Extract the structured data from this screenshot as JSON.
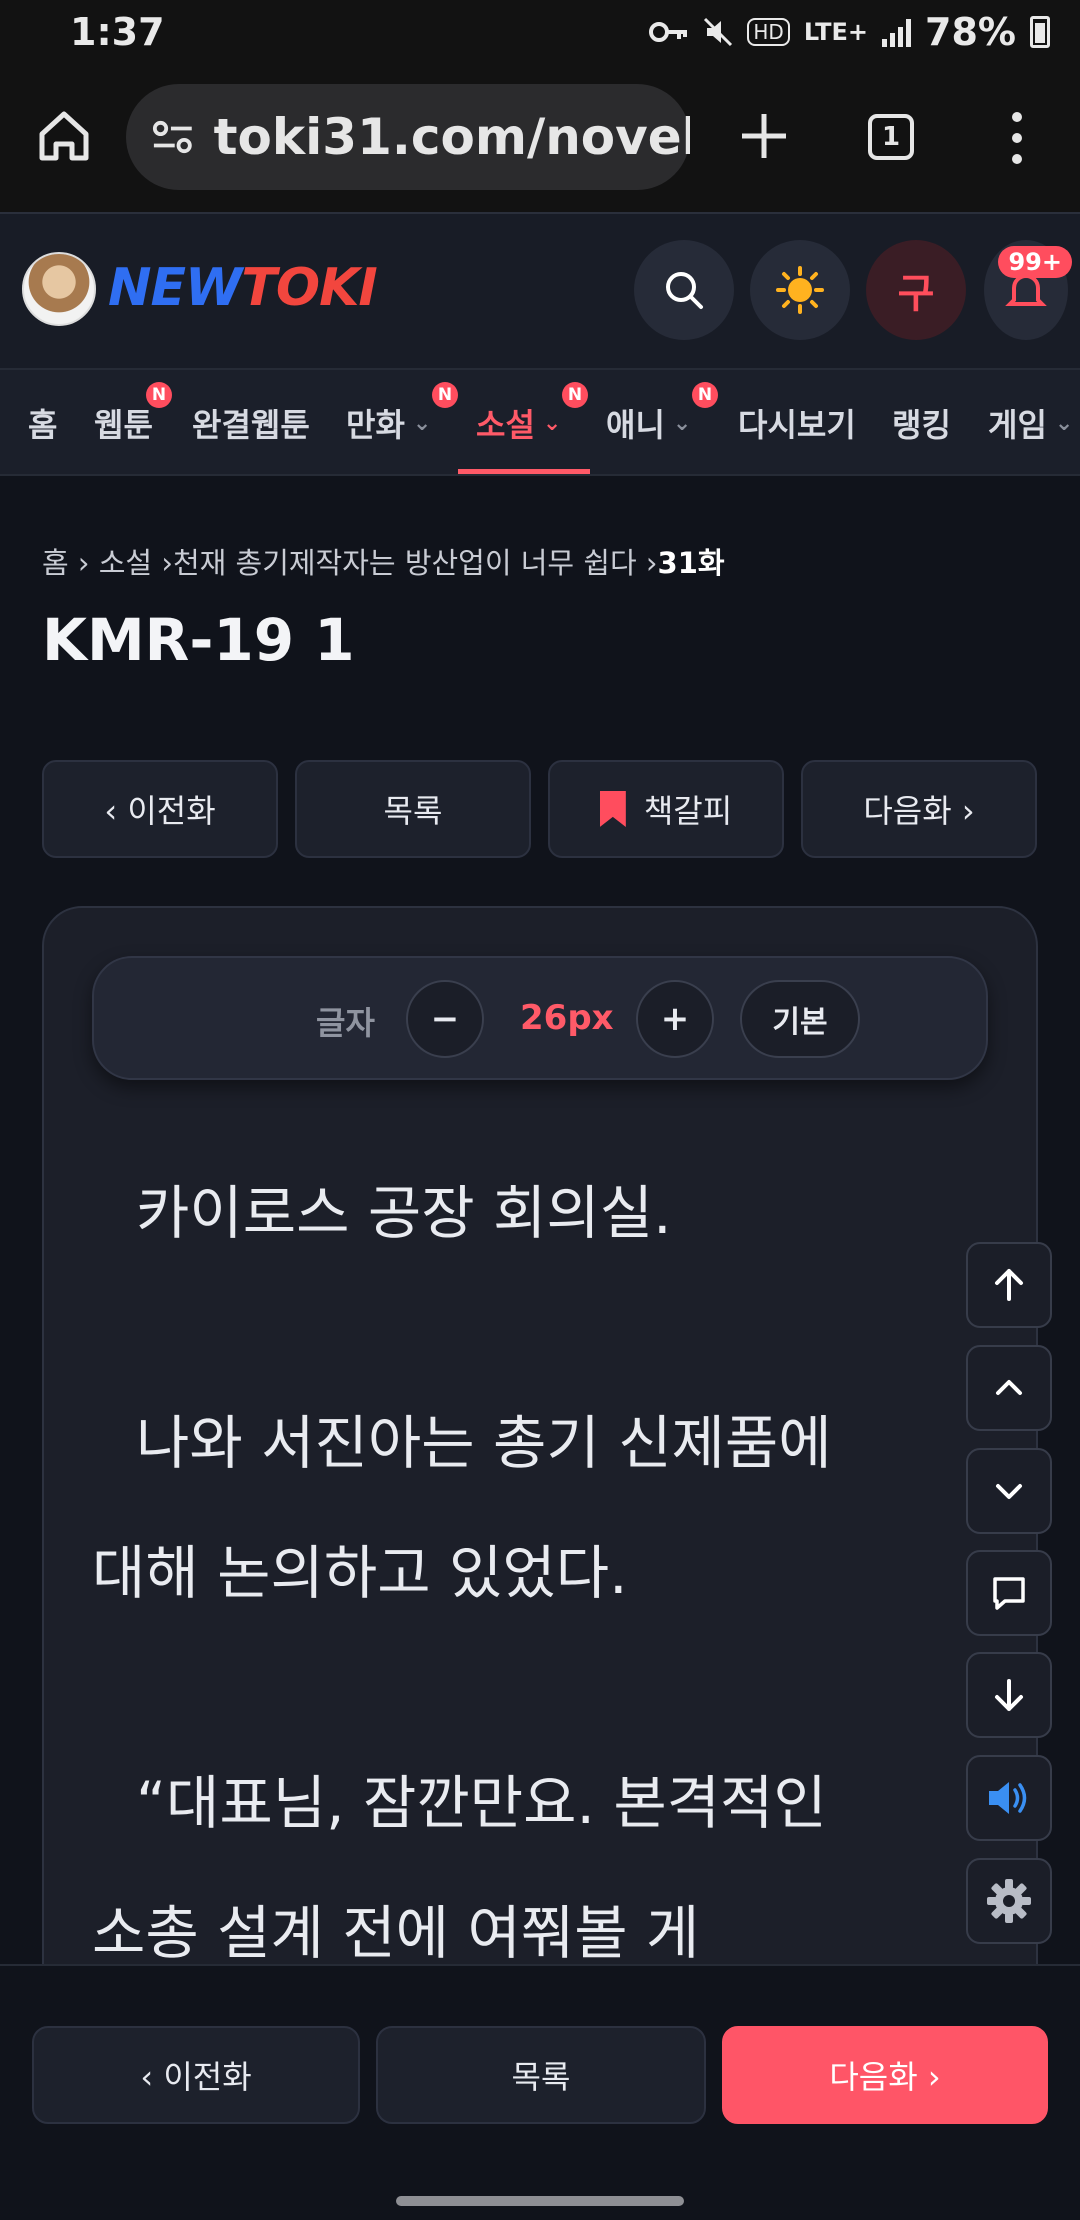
{
  "status": {
    "time": "1:37",
    "battery": "78%",
    "network": "LTE+",
    "hd": "HD"
  },
  "browser": {
    "url": "toki31.com/novel/",
    "tab_count": "1"
  },
  "site": {
    "logo_new": "NEW",
    "logo_toki": "TOKI",
    "user_initial": "구",
    "notif_count": "99+"
  },
  "nav": {
    "items": [
      {
        "label": "홈"
      },
      {
        "label": "웹툰",
        "badge": "N"
      },
      {
        "label": "완결웹툰"
      },
      {
        "label": "만화",
        "badge": "N"
      },
      {
        "label": "소설",
        "badge": "N"
      },
      {
        "label": "애니",
        "badge": "N"
      },
      {
        "label": "다시보기"
      },
      {
        "label": "랭킹"
      },
      {
        "label": "게임"
      }
    ]
  },
  "breadcrumb": {
    "home": "홈",
    "sep": "›",
    "category": "소설",
    "series": "천재 총기제작자는 방산업이 너무 쉽다",
    "episode": "31화"
  },
  "title": "KMR-19 1",
  "episode_nav": {
    "prev": "‹ 이전화",
    "list": "목록",
    "bookmark": "책갈피",
    "next": "다음화 ›"
  },
  "font_panel": {
    "label": "글자",
    "minus": "−",
    "size": "26px",
    "plus": "+",
    "reset": "기본"
  },
  "body_lines": [
    "카이로스 공장 회의실.",
    "나와 서진아는 총기 신제품에",
    "대해 논의하고 있었다.",
    "“대표님, 잠깐만요. 본격적인",
    "소총 설계 전에 여쭤볼 게"
  ],
  "bottom_nav": {
    "prev": "‹ 이전화",
    "list": "목록",
    "next": "다음화 ›"
  },
  "colors": {
    "accent": "#ff5567",
    "background": "#10131b",
    "card": "#1c1f29"
  }
}
